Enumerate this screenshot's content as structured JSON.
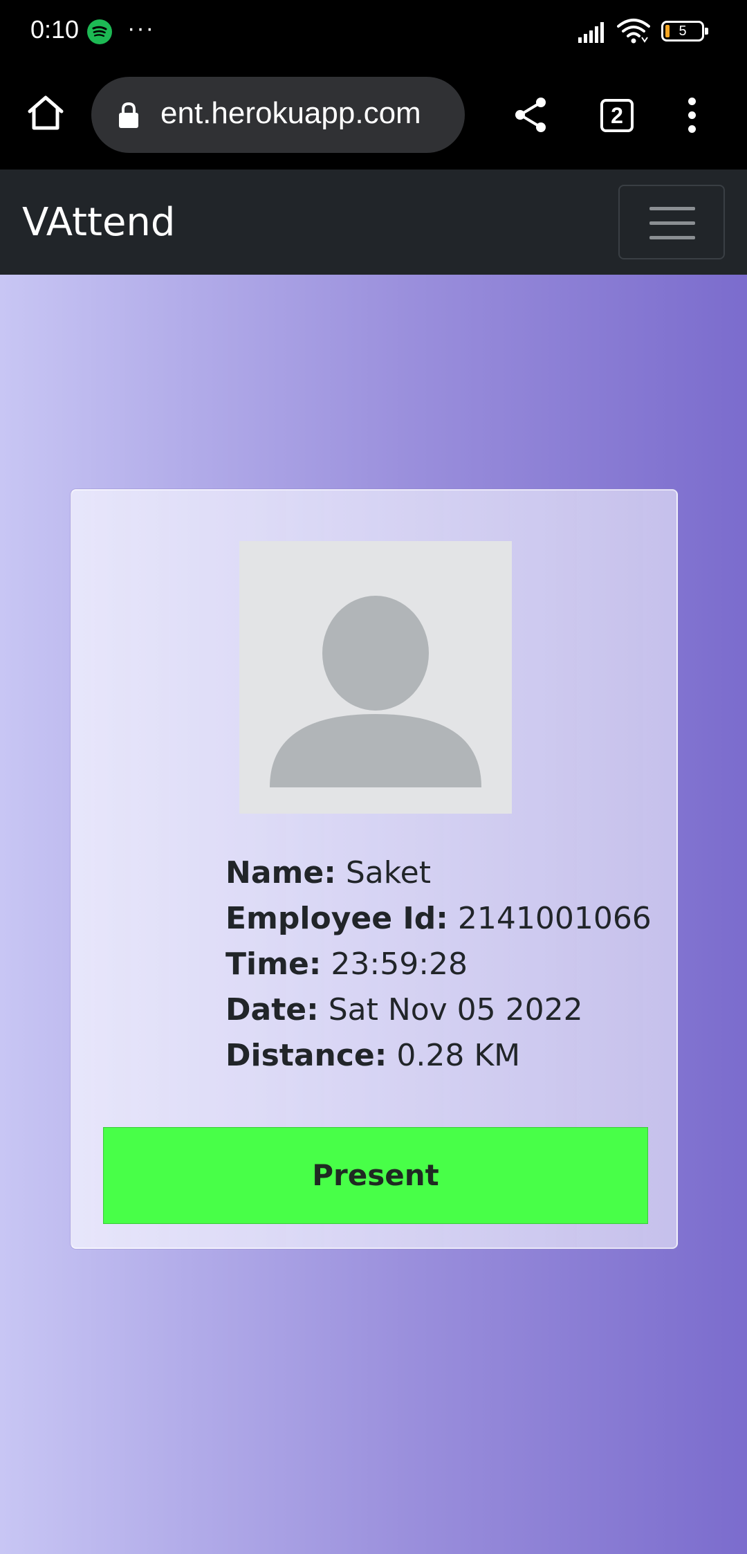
{
  "status_bar": {
    "time": "0:10",
    "more_indicator": "···",
    "battery_level": "5",
    "icons": [
      "spotify-icon",
      "signal-icon",
      "wifi-icon",
      "battery-icon"
    ]
  },
  "browser": {
    "url": "ent.herokuapp.com",
    "tab_count": "2",
    "icons": [
      "home-icon",
      "lock-icon",
      "share-icon",
      "tabs-icon",
      "menu-icon"
    ]
  },
  "navbar": {
    "brand": "VAttend",
    "toggler_icon": "hamburger-icon"
  },
  "card": {
    "avatar_icon": "user-placeholder-icon",
    "rows": [
      {
        "label": "Name:",
        "value": "Saket"
      },
      {
        "label": "Employee Id:",
        "value": "2141001066"
      },
      {
        "label": "Time:",
        "value": "23:59:28"
      },
      {
        "label": "Date:",
        "value": "Sat Nov 05 2022"
      },
      {
        "label": "Distance:",
        "value": "0.28 KM"
      }
    ],
    "status_button": "Present",
    "status_color": "#48ff48"
  },
  "colors": {
    "navbar_bg": "#212529",
    "gradient_start": "#c8c6f4",
    "gradient_end": "#7b6ccd"
  }
}
